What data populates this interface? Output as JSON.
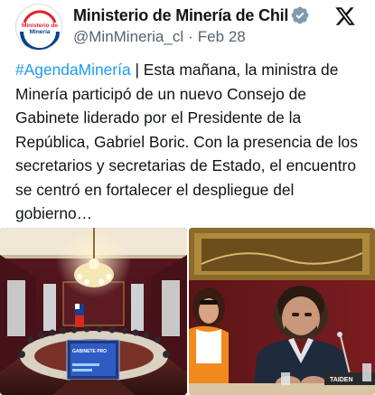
{
  "account": {
    "name": "Ministerio de Minería de Chil",
    "handle": "@MinMineria_cl",
    "separator": "·",
    "date": "Feb 28",
    "avatar_logo_line1": "Ministerio de",
    "avatar_logo_line2": "Minería",
    "verified_icon": "verified-badge-icon",
    "platform_icon": "x-logo-icon"
  },
  "tweet": {
    "hashtag": "#AgendaMinería",
    "body": " | Esta mañana, la ministra de Minería participó de un nuevo Consejo de Gabinete liderado por el Presidente de la República, Gabriel Boric. Con la presencia de los secretarios y secretarias de Estado, el encuentro se centró en fortalecer el despliegue del gobierno…"
  },
  "media": {
    "left_photo_screen_text": "GABINETE PRO",
    "right_photo_nameplate": "TAIDEN"
  },
  "colors": {
    "link": "#1d9bf0",
    "verified": "#829aab",
    "logo_red": "#e4202c",
    "logo_blue": "#0a3f8f"
  }
}
